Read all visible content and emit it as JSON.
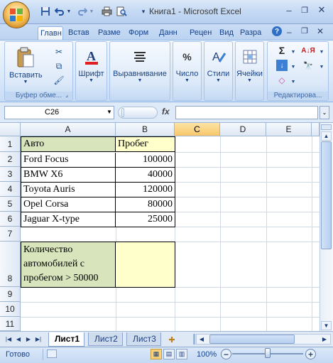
{
  "window": {
    "title": "Книга1 - Microsoft Excel",
    "minimize": "‒",
    "restore": "❐",
    "close": "✕"
  },
  "quick_access": {
    "save_icon": "save-icon",
    "undo_icon": "undo-icon",
    "redo_icon": "redo-icon",
    "print_icon": "print-icon",
    "preview_icon": "print-preview-icon",
    "customize_icon": "dropdown-icon"
  },
  "tabs": [
    "Главн",
    "Встав",
    "Разме",
    "Форм",
    "Данн",
    "Рецен",
    "Вид",
    "Разра"
  ],
  "ribbon": {
    "clipboard": {
      "label": "Буфер обме...",
      "paste": "Вставить"
    },
    "font": {
      "button": "Шрифт"
    },
    "alignment": {
      "button": "Выравнивание"
    },
    "number": {
      "button": "Число"
    },
    "styles": {
      "button": "Стили"
    },
    "cells": {
      "button": "Ячейки"
    },
    "editing": {
      "label": "Редактирова..."
    }
  },
  "formula_bar": {
    "name_box": "C26",
    "fx": "fx",
    "formula": ""
  },
  "grid": {
    "columns": [
      "A",
      "B",
      "C",
      "D",
      "E"
    ],
    "selected_column": "C",
    "rows": [
      "1",
      "2",
      "3",
      "4",
      "5",
      "6",
      "7",
      "8",
      "9",
      "10",
      "11"
    ],
    "header": {
      "a": "Авто",
      "b": "Пробег"
    },
    "data": [
      {
        "a": "Ford Focus",
        "b": "100000"
      },
      {
        "a": "BMW X6",
        "b": "40000"
      },
      {
        "a": "Toyota Auris",
        "b": "120000"
      },
      {
        "a": "Opel Corsa",
        "b": "80000"
      },
      {
        "a": "Jaguar X-type",
        "b": "25000"
      }
    ],
    "summary_lines": [
      "Количество",
      "автомобилей с",
      "пробегом > 50000"
    ],
    "summary_value": ""
  },
  "sheets": [
    "Лист1",
    "Лист2",
    "Лист3"
  ],
  "active_sheet": "Лист1",
  "status": {
    "ready": "Готово",
    "zoom": "100%"
  },
  "colors": {
    "header_fill": "#d8e4bc",
    "value_fill": "#ffffcc",
    "selected_column": "#f8c66b"
  }
}
